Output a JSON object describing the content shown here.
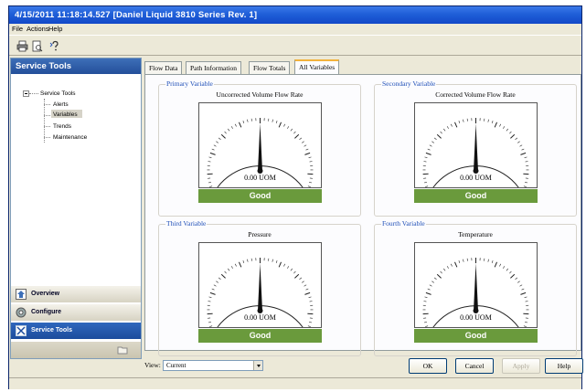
{
  "window": {
    "title": "4/15/2011 11:18:14.527 [Daniel Liquid 3810 Series Rev. 1]"
  },
  "menu": [
    {
      "label": "File"
    },
    {
      "label": "Actions"
    },
    {
      "label": "Help"
    }
  ],
  "toolbar": {
    "icons": [
      "print-icon",
      "print-preview-icon",
      "help-icon"
    ]
  },
  "sidebar": {
    "title": "Service Tools",
    "tree": {
      "root": "Service Tools",
      "children": [
        {
          "label": "Alerts",
          "selected": false
        },
        {
          "label": "Variables",
          "selected": true
        },
        {
          "label": "Trends",
          "selected": false
        },
        {
          "label": "Maintenance",
          "selected": false
        }
      ]
    },
    "nav": [
      {
        "label": "Overview",
        "icon": "overview-icon",
        "active": false
      },
      {
        "label": "Configure",
        "icon": "configure-icon",
        "active": false
      },
      {
        "label": "Service Tools",
        "icon": "service-tools-icon",
        "active": true
      }
    ]
  },
  "tabs": [
    {
      "label": "Flow Data",
      "active": false
    },
    {
      "label": "Path Information",
      "active": false
    },
    {
      "label": "Flow Totals",
      "active": false
    },
    {
      "label": "All Variables",
      "active": true
    }
  ],
  "gauges": [
    {
      "group": "Primary Variable",
      "name": "Uncorrected Volume Flow Rate",
      "value": "0.00 UOM",
      "status": "Good"
    },
    {
      "group": "Secondary Variable",
      "name": "Corrected Volume Flow Rate",
      "value": "0.00 UOM",
      "status": "Good"
    },
    {
      "group": "Third Variable",
      "name": "Pressure",
      "value": "0.00 UOM",
      "status": "Good"
    },
    {
      "group": "Fourth Variable",
      "name": "Temperature",
      "value": "0.00 UOM",
      "status": "Good"
    }
  ],
  "colors": {
    "status_good": "#6a9a3c",
    "group_label": "#2050b8",
    "title_bar": "#1f5fd8"
  },
  "bottom": {
    "view_label": "View:",
    "view_value": "Current",
    "buttons": [
      {
        "label": "OK",
        "enabled": true
      },
      {
        "label": "Cancel",
        "enabled": true
      },
      {
        "label": "Apply",
        "enabled": false
      },
      {
        "label": "Help",
        "enabled": true
      }
    ]
  }
}
